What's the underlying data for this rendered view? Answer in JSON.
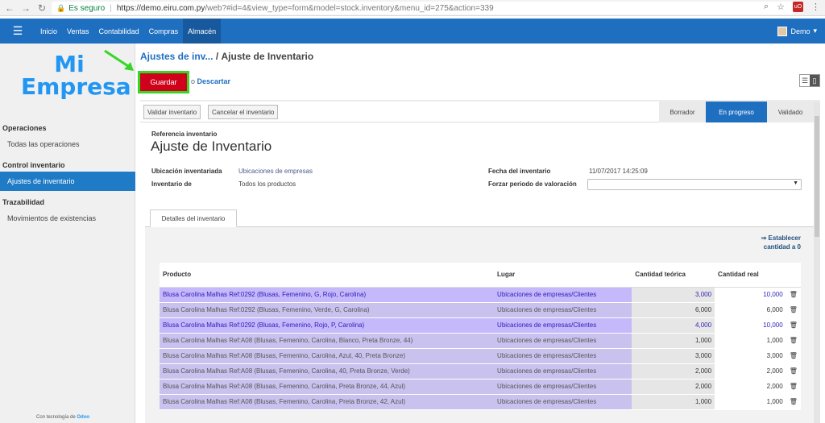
{
  "browser": {
    "secure_label": "Es seguro",
    "url_host": "https://demo.eiru.com.py",
    "url_path": "/web?#id=4&view_type=form&model=stock.inventory&menu_id=275&action=339"
  },
  "topnav": {
    "items": [
      "Inicio",
      "Ventas",
      "Contabilidad",
      "Compras",
      "Almacén"
    ],
    "user": "Demo"
  },
  "sidebar": {
    "logo_line1": "Mi",
    "logo_line2": "Empresa",
    "sections": [
      {
        "title": "Operaciones",
        "items": [
          "Todas las operaciones"
        ]
      },
      {
        "title": "Control inventario",
        "items": [
          "Ajustes de inventario"
        ]
      },
      {
        "title": "Trazabilidad",
        "items": [
          "Movimientos de existencias"
        ]
      }
    ],
    "powered_prefix": "Con tecnología de",
    "powered_brand": "Odoo"
  },
  "breadcrumb": {
    "parent": "Ajustes de inv...",
    "separator": "/",
    "current": "Ajuste de Inventario"
  },
  "buttons": {
    "save": "Guardar",
    "discard_prefix": "o",
    "discard": "Descartar",
    "validate": "Validar inventario",
    "cancel": "Cancelar el inventario"
  },
  "stages": [
    "Borrador",
    "En progreso",
    "Validado"
  ],
  "form": {
    "ref_label": "Referencia inventario",
    "ref_value": "Ajuste de Inventario",
    "location_label": "Ubicación inventariada",
    "location_value": "Ubicaciones de empresas",
    "inventory_of_label": "Inventario de",
    "inventory_of_value": "Todos los productos",
    "date_label": "Fecha del inventario",
    "date_value": "11/07/2017 14:25:09",
    "period_label": "Forzar periodo de valoración",
    "period_value": ""
  },
  "tab": {
    "label": "Detalles del inventario",
    "restock_line1": "⇒ Establecer",
    "restock_line2": "cantidad a 0"
  },
  "table": {
    "headers": [
      "Producto",
      "Lugar",
      "Cantidad teórica",
      "Cantidad real"
    ],
    "rows": [
      {
        "product": "Blusa Carolina Malhas Ref:0292 (Blusas, Femenino, G, Rojo, Carolina)",
        "location": "Ubicaciones de empresas/Clientes",
        "theoretical": "3,000",
        "real": "10,000",
        "changed": true
      },
      {
        "product": "Blusa Carolina Malhas Ref:0292 (Blusas, Femenino, Verde, G, Carolina)",
        "location": "Ubicaciones de empresas/Clientes",
        "theoretical": "6,000",
        "real": "6,000",
        "changed": false
      },
      {
        "product": "Blusa Carolina Malhas Ref:0292 (Blusas, Femenino, Rojo, P, Carolina)",
        "location": "Ubicaciones de empresas/Clientes",
        "theoretical": "4,000",
        "real": "10,000",
        "changed": true
      },
      {
        "product": "Blusa Carolina Malhas Ref:A08 (Blusas, Femenino, Carolina, Blanco, Preta Bronze, 44)",
        "location": "Ubicaciones de empresas/Clientes",
        "theoretical": "1,000",
        "real": "1,000",
        "changed": false
      },
      {
        "product": "Blusa Carolina Malhas Ref:A08 (Blusas, Femenino, Carolina, Azul, 40, Preta Bronze)",
        "location": "Ubicaciones de empresas/Clientes",
        "theoretical": "3,000",
        "real": "3,000",
        "changed": false
      },
      {
        "product": "Blusa Carolina Malhas Ref:A08 (Blusas, Femenino, Carolina, 40, Preta Bronze, Verde)",
        "location": "Ubicaciones de empresas/Clientes",
        "theoretical": "2,000",
        "real": "2,000",
        "changed": false
      },
      {
        "product": "Blusa Carolina Malhas Ref:A08 (Blusas, Femenino, Carolina, Preta Bronze, 44, Azul)",
        "location": "Ubicaciones de empresas/Clientes",
        "theoretical": "2,000",
        "real": "2,000",
        "changed": false
      },
      {
        "product": "Blusa Carolina Malhas Ref:A08 (Blusas, Femenino, Carolina, Preta Bronze, 42, Azul)",
        "location": "Ubicaciones de empresas/Clientes",
        "theoretical": "1,000",
        "real": "1,000",
        "changed": false
      }
    ]
  },
  "colors": {
    "nav_blue": "#1f6fc1",
    "save_red": "#d0021b",
    "highlight_green": "#37d626",
    "row_purple": "#c9c2ee"
  }
}
